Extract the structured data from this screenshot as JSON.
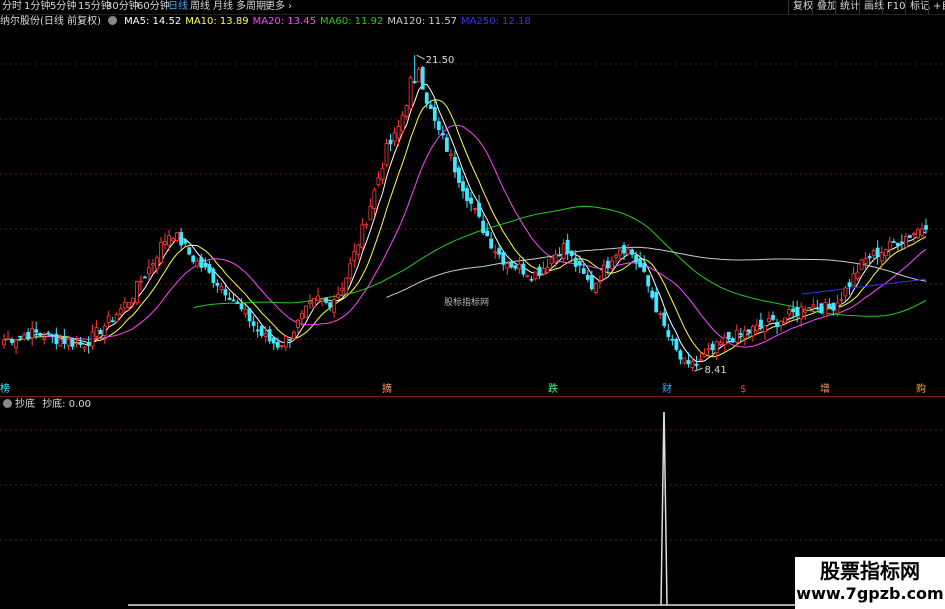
{
  "toolbar": {
    "left_items": [
      "分时",
      "1分钟",
      "5分钟",
      "15分钟",
      "30分钟",
      "60分钟",
      "日线",
      "周线",
      "月线",
      "多周期",
      "更多"
    ],
    "active": "日线",
    "right_items": [
      "复权",
      "叠加",
      "统计",
      "画线",
      "F10",
      "标记",
      "+自"
    ]
  },
  "legend": {
    "stock_name": "纳尔股份(日线 前复权)",
    "ma": [
      {
        "label": "MA5: 14.52",
        "color": "#ffffff"
      },
      {
        "label": "MA10: 13.89",
        "color": "#ffff44"
      },
      {
        "label": "MA20: 13.45",
        "color": "#ff44ff"
      },
      {
        "label": "MA60: 11.92",
        "color": "#22cc22"
      },
      {
        "label": "MA120: 11.57",
        "color": "#cccccc"
      },
      {
        "label": "MA250: 12.18",
        "color": "#3333ff"
      }
    ]
  },
  "annotations": {
    "high_label": "21.50",
    "low_label": "8.41",
    "center_watermark": "股标指标网"
  },
  "bottom_markers": [
    "榜",
    "摘",
    "跌",
    "财",
    "$",
    "增",
    "购"
  ],
  "indicator": {
    "name": "抄底",
    "value_label": "抄底: 0.00"
  },
  "watermark": {
    "title": "股票指标网",
    "url": "www.7gpzb.com"
  },
  "colors": {
    "up": "#ff3b3b",
    "down": "#44e6ff",
    "grid": "#5a1a1a",
    "ma5": "#ffffff",
    "ma10": "#ffff44",
    "ma20": "#ff44ff",
    "ma60": "#22cc22",
    "ma120": "#cccccc",
    "ma250": "#3333ff"
  },
  "chart_data": {
    "type": "line",
    "title": "",
    "ylim": [
      8.0,
      22.5
    ],
    "close_path": [
      9.7,
      9.8,
      9.9,
      10.0,
      9.9,
      9.8,
      9.7,
      9.6,
      9.5,
      9.8,
      10.2,
      10.6,
      11.0,
      11.5,
      12.2,
      12.8,
      13.6,
      14.2,
      13.8,
      13.2,
      12.8,
      12.4,
      12.0,
      11.6,
      11.0,
      10.6,
      10.0,
      9.7,
      9.5,
      9.8,
      10.4,
      11.0,
      11.4,
      11.2,
      11.6,
      12.4,
      13.6,
      14.8,
      16.2,
      17.6,
      18.2,
      19.5,
      21.5,
      19.8,
      18.6,
      17.8,
      16.8,
      15.9,
      15.0,
      14.2,
      13.5,
      13.0,
      12.8,
      12.6,
      12.4,
      12.7,
      13.2,
      13.6,
      13.0,
      12.4,
      11.9,
      12.5,
      13.2,
      13.6,
      13.3,
      12.6,
      11.6,
      10.5,
      9.6,
      8.9,
      8.41,
      8.8,
      9.2,
      9.5,
      9.8,
      9.9,
      10.1,
      10.2,
      10.4,
      10.5,
      10.7,
      10.9,
      11.2,
      11.1,
      11.0,
      11.3,
      11.9,
      12.6,
      13.1,
      13.3,
      13.5,
      13.8,
      14.0,
      14.2,
      14.52
    ],
    "series": [
      {
        "name": "MA5",
        "values": [
          14.52
        ]
      },
      {
        "name": "MA10",
        "values": [
          13.89
        ]
      },
      {
        "name": "MA20",
        "values": [
          13.45
        ]
      },
      {
        "name": "MA60",
        "values": [
          11.92
        ]
      },
      {
        "name": "MA120",
        "values": [
          11.57
        ]
      },
      {
        "name": "MA250",
        "values": [
          12.18
        ]
      }
    ],
    "indicator_series": {
      "name": "抄底",
      "spike_at_index": 70,
      "value": 0.0
    }
  }
}
